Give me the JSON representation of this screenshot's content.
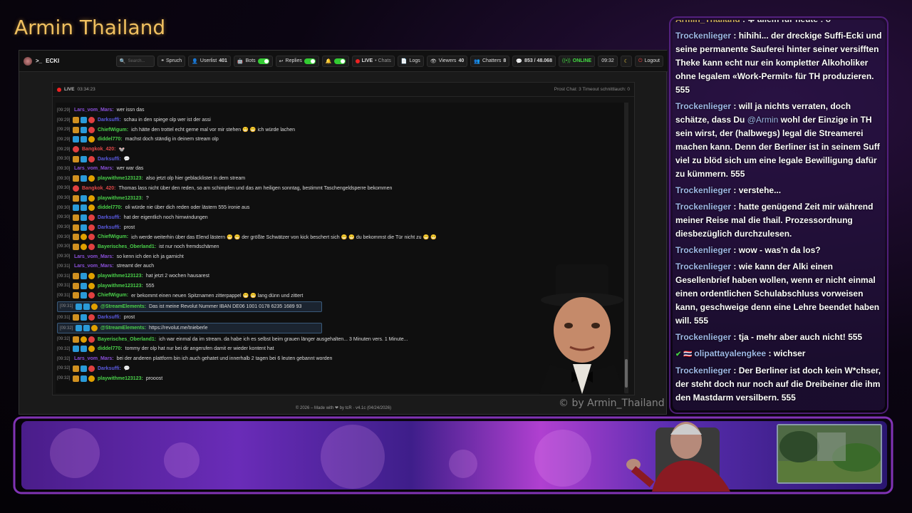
{
  "overlay": {
    "title": "Armin Thailand",
    "watermark": "© by Armin_Thailand"
  },
  "nav": {
    "brand": "ECKI",
    "search_placeholder": "Search...",
    "spruch": "Spruch",
    "userlist": "Userlist",
    "userlist_count": "401",
    "bots": "Bots",
    "replies": "Replies",
    "live": "LIVE",
    "chats": "• Chats",
    "logs": "Logs",
    "viewers": "Viewers",
    "viewers_count": "40",
    "chatters": "Chatters",
    "chatters_count": "8",
    "messages": "853 / 48.068",
    "online": "ONLINE",
    "time": "09:32",
    "logout": "Logout"
  },
  "livebar": {
    "status": "LIVE",
    "uptime": "03:34:23",
    "right": "Prost Chat: 3  Timeout schnittlauch: 0"
  },
  "colors": {
    "lars": "#8a4fd8",
    "darksuffi": "#5a5ae0",
    "chief": "#4ad04a",
    "diddel": "#4ad04a",
    "bangkok": "#e04848",
    "playwith": "#4ad04a",
    "bayer": "#4ad04a",
    "stream": "#4ad04a"
  },
  "chat": [
    {
      "ts": "[09:29]",
      "badges": [],
      "user": "Lars_vom_Mars",
      "color": "lars",
      "text": "wer issn das"
    },
    {
      "ts": "[09:29]",
      "badges": [
        "b1",
        "b2",
        "b3"
      ],
      "user": "Darksuffi",
      "color": "darksuffi",
      "text": "schau in den spiege olp wer ist der assi"
    },
    {
      "ts": "[09:29]",
      "badges": [
        "b1",
        "b2",
        "b3"
      ],
      "user": "ChiefWigum",
      "color": "chief",
      "text": "ich hätte den trottel echt gerne mal vor mir stehen 😁 😁 ich würde lachen"
    },
    {
      "ts": "[09:29]",
      "badges": [
        "b2",
        "b2",
        "b4"
      ],
      "user": "diddel770",
      "color": "diddel",
      "text": "machst doch ständig in deinem stream olp"
    },
    {
      "ts": "[09:29]",
      "badges": [
        "b3"
      ],
      "user": "Bangkok_420",
      "color": "bangkok",
      "text": "🐭"
    },
    {
      "ts": "[09:30]",
      "badges": [
        "b1",
        "b2",
        "b3"
      ],
      "user": "Darksuffi",
      "color": "darksuffi",
      "text": "💬"
    },
    {
      "ts": "[09:30]",
      "badges": [],
      "user": "Lars_vom_Mars",
      "color": "lars",
      "text": "wer war das"
    },
    {
      "ts": "[09:30]",
      "badges": [
        "b1",
        "b2",
        "b4"
      ],
      "user": "playwithme123123",
      "color": "playwith",
      "text": "also jetzt olp hier geblacklistet in dem stream"
    },
    {
      "ts": "[09:30]",
      "badges": [
        "b3"
      ],
      "user": "Bangkok_420",
      "color": "bangkok",
      "text": "Thomas lass nicht über den reden, so am schimpfen und das am heiligen sonntag, bestimmt Taschengeldsperre bekommen"
    },
    {
      "ts": "[09:30]",
      "badges": [
        "b1",
        "b2",
        "b4"
      ],
      "user": "playwithme123123",
      "color": "playwith",
      "text": "?"
    },
    {
      "ts": "[09:30]",
      "badges": [
        "b2",
        "b2",
        "b4"
      ],
      "user": "diddel770",
      "color": "diddel",
      "text": "oli würde nie über dich reden oder lästern 555 ironie aus"
    },
    {
      "ts": "[09:30]",
      "badges": [
        "b1",
        "b2",
        "b3"
      ],
      "user": "Darksuffi",
      "color": "darksuffi",
      "text": "hat der eigentlich noch hirnwindungen"
    },
    {
      "ts": "[09:30]",
      "badges": [
        "b1",
        "b2",
        "b3"
      ],
      "user": "Darksuffi",
      "color": "darksuffi",
      "text": "prost"
    },
    {
      "ts": "[09:30]",
      "badges": [
        "b1",
        "b4",
        "b3"
      ],
      "user": "ChiefWigum",
      "color": "chief",
      "text": "ich werde weiterhin über das Elend lästern 😁 😁 der größte Schwätzer von kick beschert sich 😁 😁 du bekommst die Tür nicht zu 😁 😁"
    },
    {
      "ts": "[09:30]",
      "badges": [
        "b1",
        "b4",
        "b3"
      ],
      "user": "Bayerisches_Oberland1",
      "color": "bayer",
      "text": "ist nur noch fremdschämen"
    },
    {
      "ts": "[09:30]",
      "badges": [],
      "user": "Lars_vom_Mars",
      "color": "lars",
      "text": "so kenn ich den ich ja garnicht"
    },
    {
      "ts": "[09:31]",
      "badges": [],
      "user": "Lars_vom_Mars",
      "color": "lars",
      "text": "streamt der auch"
    },
    {
      "ts": "[09:31]",
      "badges": [
        "b1",
        "b2",
        "b4"
      ],
      "user": "playwithme123123",
      "color": "playwith",
      "text": "hat jetzt 2 wochen hausarest"
    },
    {
      "ts": "[09:31]",
      "badges": [
        "b1",
        "b2",
        "b4"
      ],
      "user": "playwithme123123",
      "color": "playwith",
      "text": "555"
    },
    {
      "ts": "[09:31]",
      "badges": [
        "b1",
        "b2",
        "b3"
      ],
      "user": "ChiefWigum",
      "color": "chief",
      "text": "er bekommt einen neuen Spitznamen zitterpappel 😁 😁 lang dünn und zittert"
    },
    {
      "ts": "[09:31]",
      "badges": [
        "b2",
        "b2",
        "b4"
      ],
      "user": "@StreamElements",
      "color": "stream",
      "text": "Das ist meine Revolut Nummer IBAN DE06 1001 0178 6235 1689 93",
      "hl": true
    },
    {
      "ts": "[09:31]",
      "badges": [
        "b1",
        "b2",
        "b3"
      ],
      "user": "Darksuffi",
      "color": "darksuffi",
      "text": "prost"
    },
    {
      "ts": "[09:32]",
      "badges": [
        "b2",
        "b2",
        "b4"
      ],
      "user": "@StreamElements",
      "color": "stream",
      "text": "https://revolut.me/tnieberle",
      "hl": true
    },
    {
      "ts": "[09:32]",
      "badges": [
        "b1",
        "b4",
        "b3"
      ],
      "user": "Bayerisches_Oberland1",
      "color": "bayer",
      "text": "ich war einmal da im stream. da habe ich es selbst beim grauen länger ausgehalten... 3 Minuten vers. 1 Minute..."
    },
    {
      "ts": "[09:32]",
      "badges": [
        "b2",
        "b2",
        "b4"
      ],
      "user": "diddel770",
      "color": "diddel",
      "text": "tommy der olp hat nur bei dir angerufen damit er wieder kontent hat"
    },
    {
      "ts": "[09:32]",
      "badges": [],
      "user": "Lars_vom_Mars",
      "color": "lars",
      "text": "bei der anderen plattform bin ich auch gehatet und innerhalb 2 tagen bei 6 leuten gebannt worden"
    },
    {
      "ts": "[09:32]",
      "badges": [
        "b1",
        "b2",
        "b3"
      ],
      "user": "Darksuffi",
      "color": "darksuffi",
      "text": "💬"
    },
    {
      "ts": "[09:32]",
      "badges": [
        "b1",
        "b2",
        "b4"
      ],
      "user": "playwithme123123",
      "color": "playwith",
      "text": "prooost"
    }
  ],
  "footer": "© 2026 – Made with ❤ by tcR · v4.1c (04/24/2026)",
  "sidechat": [
    {
      "user": "Armin_Thailand",
      "text": "✱ allem für heute : ô",
      "cut": true
    },
    {
      "user": "Trockenlieger",
      "text": "hihihi... der dreckige Suffi-Ecki und seine permanente Sauferei hinter seiner versifften Theke kann echt nur ein kompletter Alkoholiker ohne legalem «Work-Permit» für TH produzieren. 555"
    },
    {
      "user": "Trockenlieger",
      "pre": "will ja nichts verraten, doch schätze, dass Du ",
      "mention": "@Armin",
      "text": " wohl der Einzige in TH sein wirst, der (halbwegs) legal die Streamerei machen kann. Denn der Berliner ist in seinem Suff viel zu blöd sich um eine legale Bewilligung dafür zu kümmern. 555"
    },
    {
      "user": "Trockenlieger",
      "text": "verstehe..."
    },
    {
      "user": "Trockenlieger",
      "text": "hatte genügend Zeit mir während meiner Reise mal die thail. Prozessordnung diesbezüglich durchzulesen."
    },
    {
      "user": "Trockenlieger",
      "text": "wow - was'n da los?"
    },
    {
      "user": "Trockenlieger",
      "text": "wie kann der Alki einen Gesellenbrief haben wollen, wenn er nicht einmal einen ordentlichen Schulabschluss vorweisen kann, geschweige denn eine Lehre beendet haben will. 555"
    },
    {
      "user": "Trockenlieger",
      "text": "tja - mehr aber auch nicht! 555"
    },
    {
      "user": "olipattayalengkee",
      "text": "wichser",
      "verified": true
    },
    {
      "user": "Trockenlieger",
      "text": "Der Berliner ist doch kein W*chser, der steht doch nur noch auf die Dreibeiner die ihm den Mastdarm versilbern. 555"
    }
  ]
}
